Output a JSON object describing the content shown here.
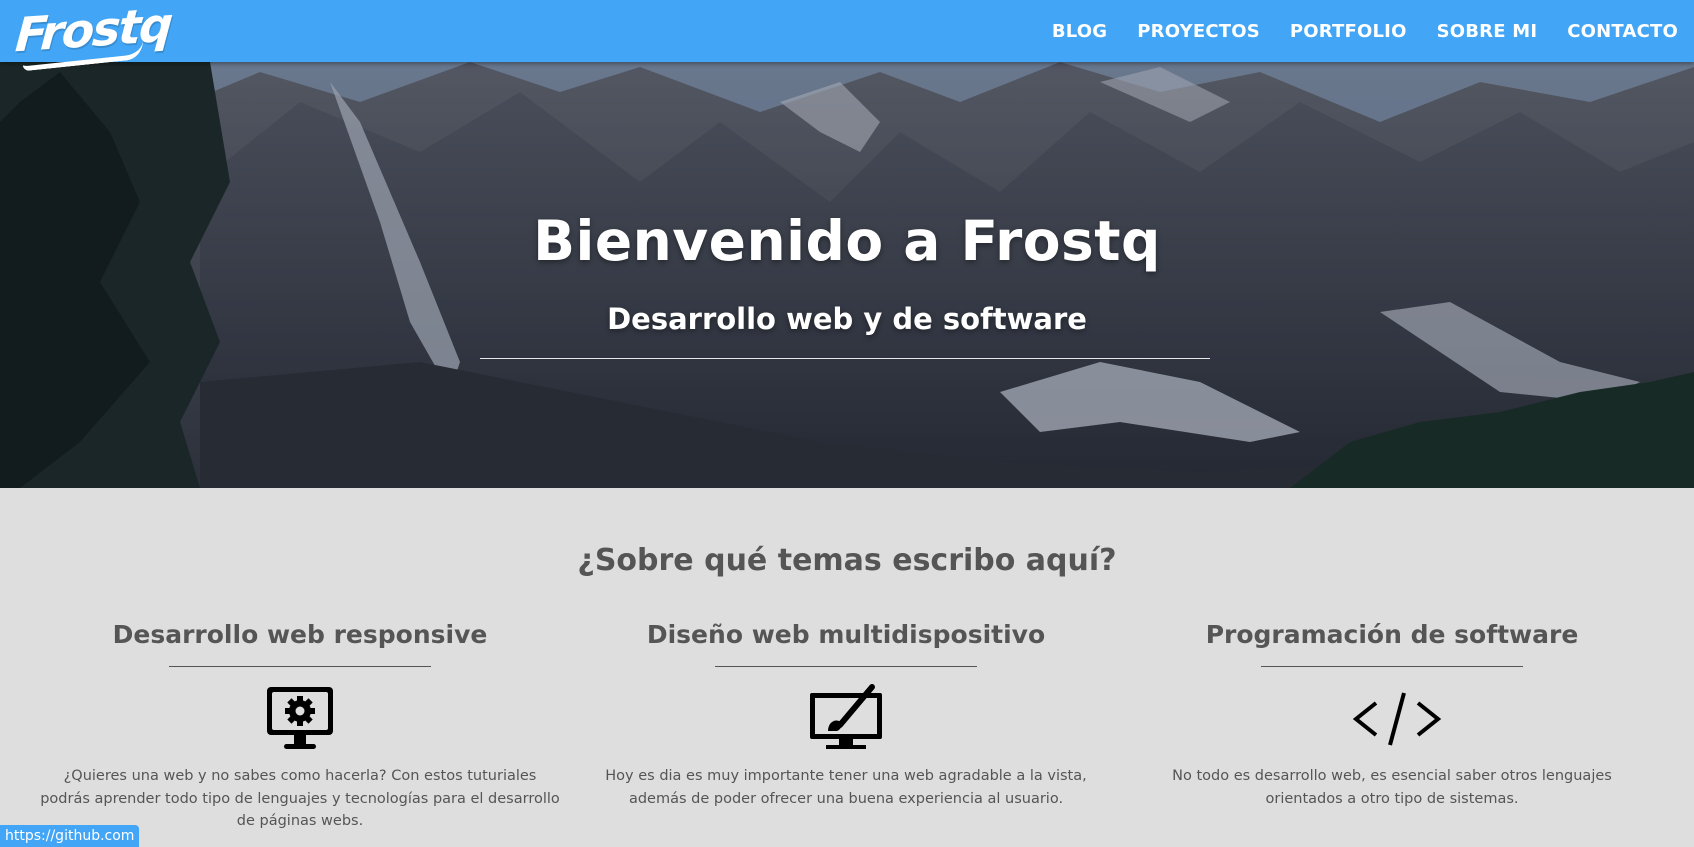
{
  "header": {
    "logo": "Frostq",
    "nav": [
      "BLOG",
      "PROYECTOS",
      "PORTFOLIO",
      "SOBRE MI",
      "CONTACTO"
    ]
  },
  "hero": {
    "title": "Bienvenido a Frostq",
    "subtitle": "Desarrollo web y de software"
  },
  "topics_section": {
    "title": "¿Sobre qué temas escribo aquí?",
    "items": [
      {
        "title": "Desarrollo web responsive",
        "icon": "monitor-gear-icon",
        "text": "¿Quieres una web y no sabes como hacerla? Con estos tuturiales podrás aprender todo tipo de lenguajes y tecnologías para el desarrollo de páginas webs."
      },
      {
        "title": "Diseño web multidispositivo",
        "icon": "monitor-brush-icon",
        "text": "Hoy es dia es muy importante tener una web agradable a la vista, además de poder ofrecer una buena experiencia al usuario."
      },
      {
        "title": "Programación de software",
        "icon": "code-icon",
        "text": "No todo es desarrollo web, es esencial saber otros lenguajes orientados a otro tipo de sistemas."
      }
    ]
  },
  "status_bar": {
    "url": "https://github.com"
  },
  "colors": {
    "header_bg": "#42a5f5",
    "page_bg": "#dedede",
    "text": "#555555"
  }
}
